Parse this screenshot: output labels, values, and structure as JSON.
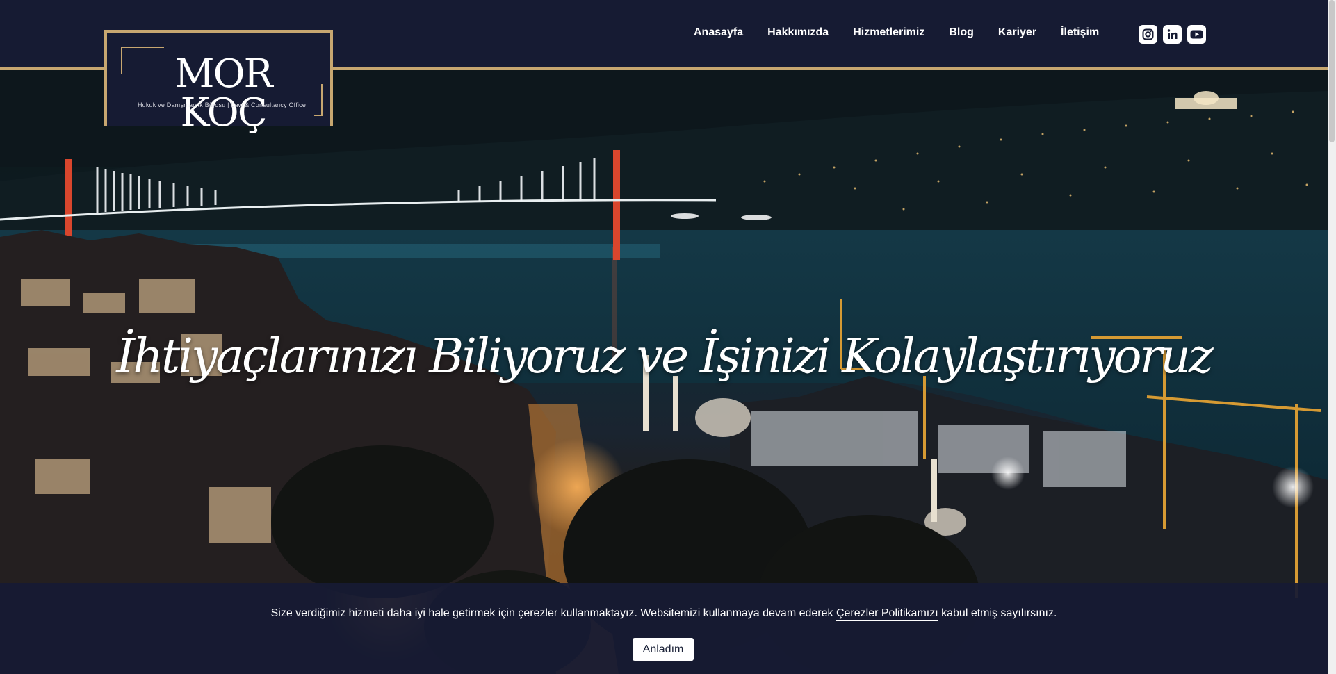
{
  "brand": {
    "name": "MOR KOÇ",
    "tagline": "Hukuk ve Danışmanlık Bürosu | Law & Consultancy Office"
  },
  "nav": {
    "items": [
      "Anasayfa",
      "Hakkımızda",
      "Hizmetlerimiz",
      "Blog",
      "Kariyer",
      "İletişim"
    ]
  },
  "socials": [
    "instagram-icon",
    "linkedin-icon",
    "youtube-icon"
  ],
  "hero": {
    "title": "İhtiyaçlarınızı Biliyoruz ve İşinizi Kolaylaştırıyoruz"
  },
  "cookie": {
    "text_before": "Size verdiğimiz hizmeti daha iyi hale getirmek için çerezler kullanmaktayız. Websitemizi kullanmaya devam ederek ",
    "link": "Çerezler Politikamızı",
    "text_after": " kabul etmiş sayılırsınız.",
    "button": "Anladım"
  },
  "colors": {
    "navy": "#161b33",
    "gold": "#c7a770",
    "white": "#ffffff"
  }
}
